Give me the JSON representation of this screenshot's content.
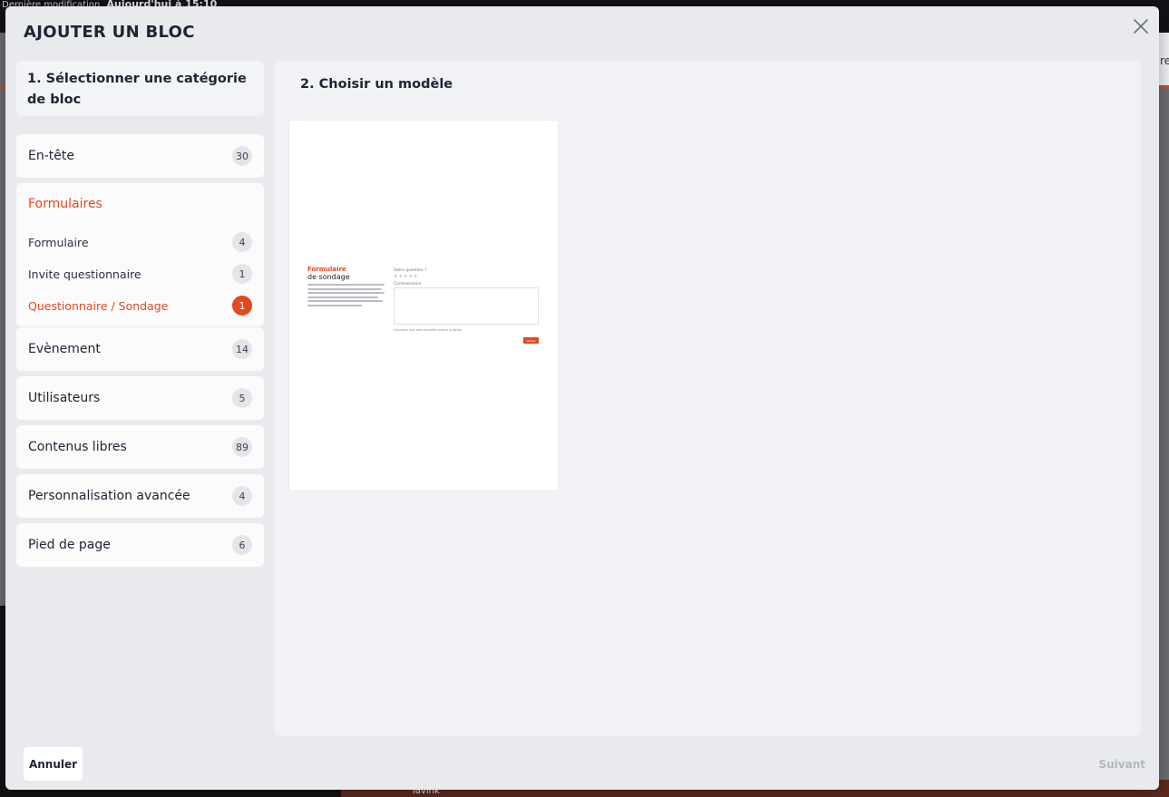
{
  "background": {
    "meta_label": "Dernière modification",
    "meta_value": "Aujourd'hui à 15:10",
    "right_text": "re",
    "bottom_label": "lavink"
  },
  "modal": {
    "title": "AJOUTER UN BLOC",
    "close_icon": "close-icon",
    "step1_title": "1. Sélectionner une catégorie de bloc",
    "step2_title": "2. Choisir un modèle"
  },
  "categories": [
    {
      "label": "En-tête",
      "count": "30"
    },
    {
      "label": "Formulaires"
    },
    {
      "label": "Evènement",
      "count": "14"
    },
    {
      "label": "Utilisateurs",
      "count": "5"
    },
    {
      "label": "Contenus libres",
      "count": "89"
    },
    {
      "label": "Personnalisation avancée",
      "count": "4"
    },
    {
      "label": "Pied de page",
      "count": "6"
    }
  ],
  "subcategories": [
    {
      "label": "Formulaire",
      "count": "4"
    },
    {
      "label": "Invite questionnaire",
      "count": "1"
    },
    {
      "label": "Questionnaire / Sondage",
      "count": "1"
    }
  ],
  "template_preview": {
    "title_line1": "Formulaire",
    "title_line2": "de sondage",
    "question_label": "Votre question ?",
    "stars": "★★★★★",
    "comment_label": "Commentaire",
    "checkbox_text": "J'accepte que mes données soient utilisées.",
    "submit_label": "Valider"
  },
  "footer": {
    "cancel_label": "Annuler",
    "next_label": "Suivant"
  },
  "colors": {
    "accent": "#e4481c",
    "badge": "#e3e5ea"
  }
}
